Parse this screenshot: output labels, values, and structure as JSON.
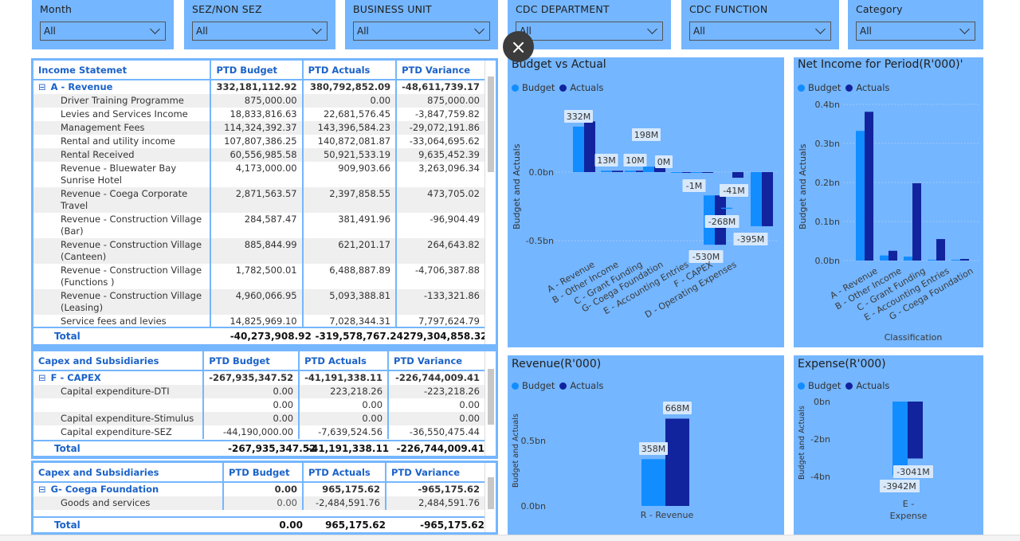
{
  "slicers": [
    {
      "label": "Month",
      "value": "All"
    },
    {
      "label": "SEZ/NON SEZ",
      "value": "All"
    },
    {
      "label": "BUSINESS UNIT",
      "value": "All"
    },
    {
      "label": "CDC DEPARTMENT",
      "value": "All"
    },
    {
      "label": "CDC FUNCTION",
      "value": "All"
    },
    {
      "label": "Category",
      "value": "All"
    }
  ],
  "colors": {
    "budget": "#118dff",
    "actuals": "#12239e",
    "panel": "#74b6ff",
    "green": "#2fa836",
    "red": "#d93838",
    "header": "#1a62c9"
  },
  "close_icon": "×",
  "income_table": {
    "headers": [
      "Income Statemet",
      "PTD Budget",
      "PTD Actuals",
      "PTD Variance"
    ],
    "group": {
      "toggle": "⊟",
      "label": "A - Revenue",
      "budget": "332,181,112.92",
      "actuals": "380,792,852.09",
      "variance": "-48,611,739.17"
    },
    "rows": [
      {
        "label": "Driver Training Programme",
        "budget": "875,000.00",
        "actuals": "0.00",
        "variance": "875,000.00",
        "vc": "g"
      },
      {
        "label": "Levies and Services Income",
        "budget": "18,833,816.63",
        "actuals": "22,681,576.45",
        "variance": "-3,847,759.82",
        "vc": "r"
      },
      {
        "label": "Management Fees",
        "budget": "114,324,392.37",
        "actuals": "143,396,584.23",
        "variance": "-29,072,191.86",
        "vc": "r"
      },
      {
        "label": "Rental and utility income",
        "budget": "107,807,386.25",
        "actuals": "140,872,081.87",
        "variance": "-33,064,695.62",
        "vc": "r"
      },
      {
        "label": "Rental Received",
        "budget": "60,556,985.58",
        "actuals": "50,921,533.19",
        "variance": "9,635,452.39",
        "vc": "g"
      },
      {
        "label": "Revenue - Bluewater Bay Sunrise Hotel",
        "budget": "4,173,000.00",
        "actuals": "909,903.66",
        "variance": "3,263,096.34",
        "vc": "g"
      },
      {
        "label": "Revenue - Coega Corporate Travel",
        "budget": "2,871,563.57",
        "actuals": "2,397,858.55",
        "variance": "473,705.02",
        "vc": "g"
      },
      {
        "label": "Revenue - Construction Village (Bar)",
        "budget": "284,587.47",
        "actuals": "381,491.96",
        "variance": "-96,904.49",
        "vc": "r"
      },
      {
        "label": "Revenue - Construction Village (Canteen)",
        "budget": "885,844.99",
        "actuals": "621,201.17",
        "variance": "264,643.82",
        "vc": "g"
      },
      {
        "label": "Revenue - Construction Village (Functions )",
        "budget": "1,782,500.01",
        "actuals": "6,488,887.89",
        "variance": "-4,706,387.88",
        "vc": "r"
      },
      {
        "label": "Revenue - Construction Village (Leasing)",
        "budget": "4,960,066.95",
        "actuals": "5,093,388.81",
        "variance": "-133,321.86",
        "vc": "r"
      },
      {
        "label": "Service fees and levies",
        "budget": "14,825,969.10",
        "actuals": "7,028,344.31",
        "variance": "7,797,624.79",
        "vc": "g"
      }
    ],
    "total": {
      "label": "Total",
      "budget": "-40,273,908.92",
      "actuals": "-319,578,767.24",
      "variance": "279,304,858.32"
    }
  },
  "capex_table": {
    "headers": [
      "Capex and Subsidiaries",
      "PTD Budget",
      "PTD Actuals",
      "PTD Variance"
    ],
    "group": {
      "toggle": "⊟",
      "label": "F - CAPEX",
      "budget": "-267,935,347.52",
      "actuals": "-41,191,338.11",
      "variance": "-226,744,009.41"
    },
    "rows": [
      {
        "label": "Capital expenditure-DTI",
        "budget": "0.00",
        "actuals": "223,218.26",
        "variance": "-223,218.26",
        "vc": "r"
      },
      {
        "label": "",
        "budget": "0.00",
        "actuals": "0.00",
        "variance": "0.00",
        "vc": "r"
      },
      {
        "label": "Capital expenditure-Stimulus",
        "budget": "0.00",
        "actuals": "0.00",
        "variance": "0.00",
        "vc": "r"
      },
      {
        "label": "Capital expenditure-SEZ",
        "budget": "-44,190,000.00",
        "actuals": "-7,639,524.56",
        "variance": "-36,550,475.44",
        "vc": "r"
      }
    ],
    "total": {
      "label": "Total",
      "budget": "-267,935,347.52",
      "actuals": "-41,191,338.11",
      "variance": "-226,744,009.41"
    }
  },
  "coega_table": {
    "headers": [
      "Capex and Subsidiaries",
      "PTD Budget",
      "PTD Actuals",
      "PTD Variance"
    ],
    "group": {
      "toggle": "⊟",
      "label": "G- Coega Foundation",
      "budget": "0.00",
      "actuals": "965,175.62",
      "variance": "-965,175.62"
    },
    "rows": [
      {
        "label": "Goods and services",
        "budget": "0.00",
        "actuals": "-2,484,591.76",
        "variance": "2,484,591.76",
        "vc": "g"
      }
    ],
    "total": {
      "label": "Total",
      "budget": "0.00",
      "actuals": "965,175.62",
      "variance": "-965,175.62"
    }
  },
  "chart_data": [
    {
      "type": "bar",
      "title": "Budget vs Actual",
      "legend": [
        "Budget",
        "Actuals"
      ],
      "ylabel": "Budget and Actuals",
      "yticks": [
        "0.0bn",
        "-0.5bn"
      ],
      "categories": [
        "A - Revenue",
        "B - Other Income",
        "C - Grant Funding",
        "G- Coega Foundation",
        "E - Accounting Entries",
        "F - CAPEX",
        "D - Operating Expenses"
      ],
      "data_labels": [
        "332M",
        "13M",
        "10M",
        "198M",
        "0M",
        "-1M",
        "-268M",
        "-530M",
        "-41M",
        "-395M"
      ],
      "series": [
        {
          "name": "Budget",
          "values": [
            332,
            13,
            10,
            198,
            0,
            -1,
            -530,
            -268,
            -395
          ]
        },
        {
          "name": "Actuals",
          "values": [
            381,
            13,
            10,
            198,
            0,
            -1,
            -530,
            -41,
            -395
          ]
        }
      ]
    },
    {
      "type": "bar",
      "title": "Net Income for Period(R'000)'",
      "legend": [
        "Budget",
        "Actuals"
      ],
      "ylabel": "Budget and Actuals",
      "xlabel": "Classification",
      "yticks": [
        "0.4bn",
        "0.3bn",
        "0.2bn",
        "0.1bn",
        "0.0bn"
      ],
      "categories": [
        "A - Revenue",
        "B - Other Income",
        "C - Grant Funding",
        "E - Accounting Entries",
        "G - Coega Foundation"
      ],
      "series": [
        {
          "name": "Budget",
          "values": [
            0.332,
            0.013,
            0.01,
            0.0,
            0.0
          ]
        },
        {
          "name": "Actuals",
          "values": [
            0.381,
            0.025,
            0.198,
            0.055,
            0.001
          ]
        }
      ]
    },
    {
      "type": "bar",
      "title": "Revenue(R'000)",
      "legend": [
        "Budget",
        "Actuals"
      ],
      "ylabel": "Budget and Actuals",
      "yticks": [
        "0.5bn",
        "0.0bn"
      ],
      "categories": [
        "R - Revenue"
      ],
      "data_labels": [
        "358M",
        "668M"
      ],
      "series": [
        {
          "name": "Budget",
          "values": [
            358
          ]
        },
        {
          "name": "Actuals",
          "values": [
            668
          ]
        }
      ]
    },
    {
      "type": "bar",
      "title": "Expense(R'000)",
      "legend": [
        "Budget",
        "Actuals"
      ],
      "ylabel": "Budget and Actuals",
      "yticks": [
        "0bn",
        "-2bn",
        "-4bn"
      ],
      "categories": [
        "E - Expense"
      ],
      "data_labels": [
        "-3942M",
        "-3041M"
      ],
      "series": [
        {
          "name": "Budget",
          "values": [
            -3942
          ]
        },
        {
          "name": "Actuals",
          "values": [
            -3041
          ]
        }
      ]
    }
  ]
}
